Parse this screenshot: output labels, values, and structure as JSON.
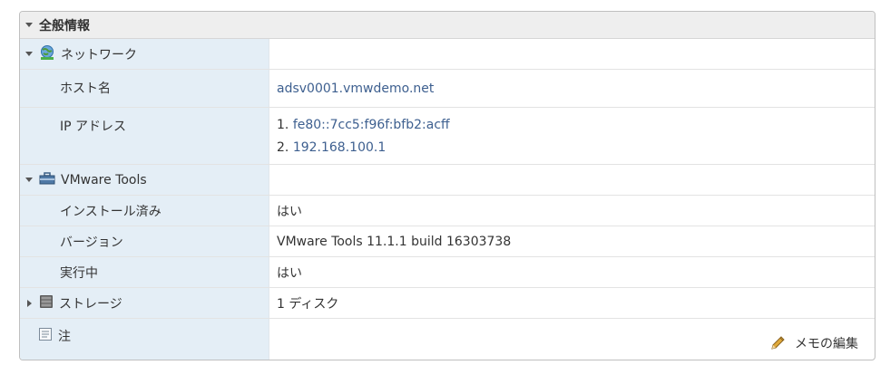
{
  "header": {
    "title": "全般情報"
  },
  "network": {
    "label": "ネットワーク",
    "hostname": {
      "label": "ホスト名",
      "value": "adsv0001.vmwdemo.net"
    },
    "ip": {
      "label": "IP アドレス",
      "items": [
        {
          "prefix": "1. ",
          "value": "fe80::7cc5:f96f:bfb2:acff"
        },
        {
          "prefix": "2. ",
          "value": "192.168.100.1"
        }
      ]
    }
  },
  "tools": {
    "label": "VMware Tools",
    "installed": {
      "label": "インストール済み",
      "value": "はい"
    },
    "version": {
      "label": "バージョン",
      "value": "VMware Tools 11.1.1 build 16303738"
    },
    "running": {
      "label": "実行中",
      "value": "はい"
    }
  },
  "storage": {
    "label": "ストレージ",
    "value": "1 ディスク"
  },
  "notes": {
    "label": "注",
    "edit_label": "メモの編集"
  },
  "colors": {
    "label_bg": "#e4eef6",
    "link": "#3d5f8f",
    "header_bg": "#eeeeee"
  },
  "icons": [
    "network-globe-icon",
    "toolbox-icon",
    "storage-disk-icon",
    "notes-icon",
    "pencil-icon"
  ]
}
